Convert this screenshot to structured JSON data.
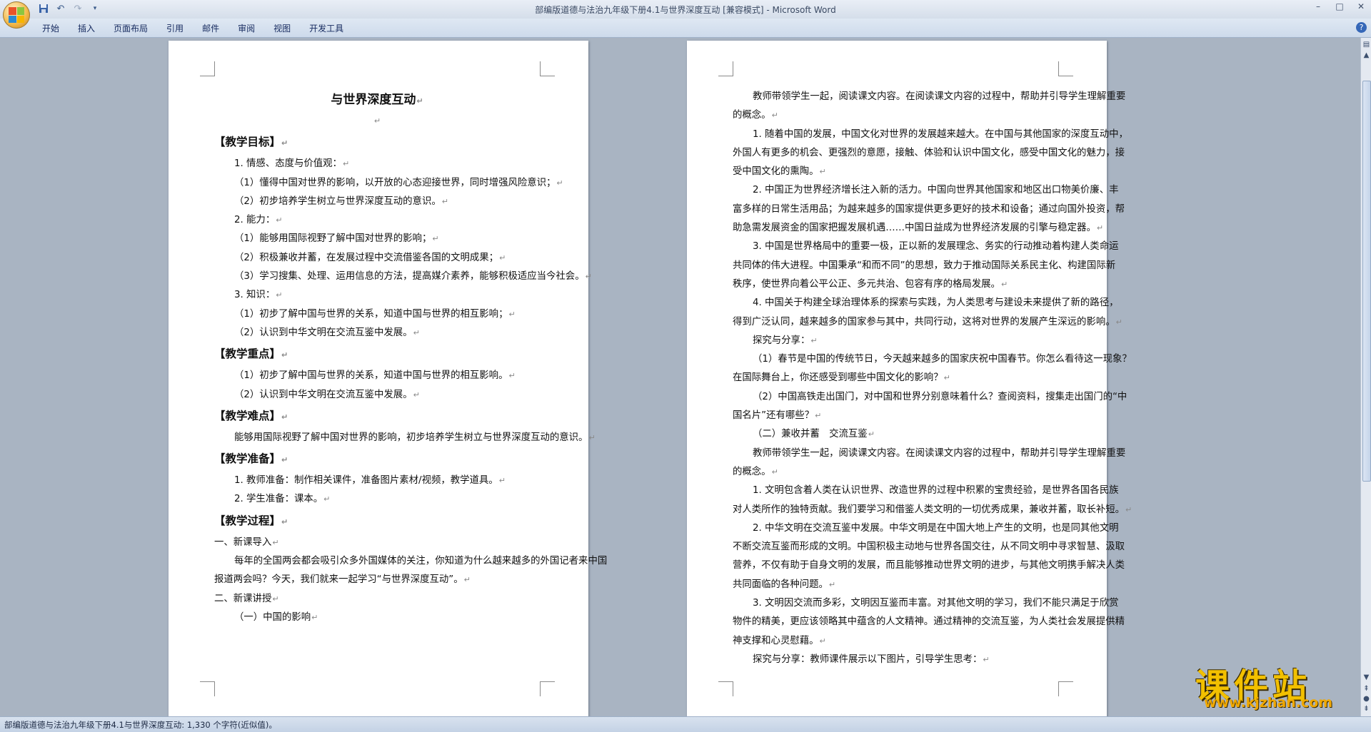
{
  "window": {
    "title": "部编版道德与法治九年级下册4.1与世界深度互动 [兼容模式] - Microsoft Word",
    "controls": {
      "minimize": "–",
      "maximize": "□",
      "close": "✕"
    }
  },
  "quick_access": {
    "save_icon": "save-icon",
    "undo_icon": "undo-icon",
    "redo_icon": "redo-icon",
    "customize_icon": "dropdown-icon"
  },
  "ribbon": {
    "tabs": [
      "开始",
      "插入",
      "页面布局",
      "引用",
      "邮件",
      "审阅",
      "视图",
      "开发工具"
    ],
    "help": "?"
  },
  "page1": {
    "title": "与世界深度互动",
    "paragraph_mark": "↵",
    "lines": [
      {
        "t": "【教学目标】",
        "s": "sec",
        "i": 0
      },
      {
        "t": "1. 情感、态度与价值观：",
        "s": "",
        "i": 28
      },
      {
        "t": "（1）懂得中国对世界的影响，以开放的心态迎接世界，同时增强风险意识；",
        "s": "",
        "i": 28
      },
      {
        "t": "（2）初步培养学生树立与世界深度互动的意识。",
        "s": "",
        "i": 28
      },
      {
        "t": "2. 能力：",
        "s": "",
        "i": 28
      },
      {
        "t": "（1）能够用国际视野了解中国对世界的影响；",
        "s": "",
        "i": 28
      },
      {
        "t": "（2）积极兼收并蓄，在发展过程中交流借鉴各国的文明成果；",
        "s": "",
        "i": 28
      },
      {
        "t": "（3）学习搜集、处理、运用信息的方法，提高媒介素养，能够积极适应当今社会。",
        "s": "",
        "i": 28
      },
      {
        "t": "3. 知识：",
        "s": "",
        "i": 28
      },
      {
        "t": "（1）初步了解中国与世界的关系，知道中国与世界的相互影响；",
        "s": "",
        "i": 28
      },
      {
        "t": "（2）认识到中华文明在交流互鉴中发展。",
        "s": "",
        "i": 28
      },
      {
        "t": "【教学重点】",
        "s": "sec",
        "i": 0
      },
      {
        "t": "（1）初步了解中国与世界的关系，知道中国与世界的相互影响。",
        "s": "",
        "i": 28
      },
      {
        "t": "（2）认识到中华文明在交流互鉴中发展。",
        "s": "",
        "i": 28
      },
      {
        "t": "【教学难点】",
        "s": "sec",
        "i": 0
      },
      {
        "t": "能够用国际视野了解中国对世界的影响，初步培养学生树立与世界深度互动的意识。",
        "s": "",
        "i": 28
      },
      {
        "t": "【教学准备】",
        "s": "sec",
        "i": 0
      },
      {
        "t": "1. 教师准备：制作相关课件，准备图片素材/视频，教学道具。",
        "s": "",
        "i": 28
      },
      {
        "t": "2. 学生准备：课本。",
        "s": "",
        "i": 28
      },
      {
        "t": "【教学过程】",
        "s": "sec",
        "i": 0
      },
      {
        "t": "一、新课导入",
        "s": "",
        "i": 0
      },
      {
        "t": "每年的全国两会都会吸引众多外国媒体的关注，你知道为什么越来越多的外国记者来中国",
        "s": "nomark",
        "i": 28
      },
      {
        "t": "报道两会吗？今天，我们就来一起学习“与世界深度互动”。",
        "s": "",
        "i": 0
      },
      {
        "t": "二、新课讲授",
        "s": "",
        "i": 0
      },
      {
        "t": "（一）中国的影响",
        "s": "",
        "i": 28
      }
    ]
  },
  "page2": {
    "lines": [
      {
        "t": "教师带领学生一起，阅读课文内容。在阅读课文内容的过程中，帮助并引导学生理解重要",
        "s": "nomark",
        "i": 28
      },
      {
        "t": "的概念。",
        "s": "",
        "i": 0
      },
      {
        "t": "1. 随着中国的发展，中国文化对世界的发展越来越大。在中国与其他国家的深度互动中，",
        "s": "nomark",
        "i": 28
      },
      {
        "t": "外国人有更多的机会、更强烈的意愿，接触、体验和认识中国文化，感受中国文化的魅力，接",
        "s": "nomark",
        "i": 0
      },
      {
        "t": "受中国文化的熏陶。",
        "s": "",
        "i": 0
      },
      {
        "t": "2. 中国正为世界经济增长注入新的活力。中国向世界其他国家和地区出口物美价廉、丰",
        "s": "nomark",
        "i": 28
      },
      {
        "t": "富多样的日常生活用品；为越来越多的国家提供更多更好的技术和设备；通过向国外投资，帮",
        "s": "nomark",
        "i": 0
      },
      {
        "t": "助急需发展资金的国家把握发展机遇……中国日益成为世界经济发展的引擎与稳定器。",
        "s": "",
        "i": 0
      },
      {
        "t": "3. 中国是世界格局中的重要一极，正以新的发展理念、务实的行动推动着构建人类命运",
        "s": "nomark",
        "i": 28
      },
      {
        "t": "共同体的伟大进程。中国秉承“和而不同”的思想，致力于推动国际关系民主化、构建国际新",
        "s": "nomark",
        "i": 0
      },
      {
        "t": "秩序，使世界向着公平公正、多元共治、包容有序的格局发展。",
        "s": "",
        "i": 0
      },
      {
        "t": "4. 中国关于构建全球治理体系的探索与实践，为人类思考与建设未来提供了新的路径，",
        "s": "nomark",
        "i": 28
      },
      {
        "t": "得到广泛认同，越来越多的国家参与其中，共同行动，这将对世界的发展产生深远的影响。",
        "s": "",
        "i": 0
      },
      {
        "t": "探究与分享：",
        "s": "",
        "i": 28
      },
      {
        "t": "（1）春节是中国的传统节日，今天越来越多的国家庆祝中国春节。你怎么看待这一现象？",
        "s": "nomark",
        "i": 28
      },
      {
        "t": "在国际舞台上，你还感受到哪些中国文化的影响？",
        "s": "",
        "i": 0
      },
      {
        "t": "（2）中国高铁走出国门，对中国和世界分别意味着什么？查阅资料，搜集走出国门的“中",
        "s": "nomark",
        "i": 28
      },
      {
        "t": "国名片”还有哪些？",
        "s": "",
        "i": 0
      },
      {
        "t": "（二）兼收并蓄　交流互鉴",
        "s": "",
        "i": 28
      },
      {
        "t": "教师带领学生一起，阅读课文内容。在阅读课文内容的过程中，帮助并引导学生理解重要",
        "s": "nomark",
        "i": 28
      },
      {
        "t": "的概念。",
        "s": "",
        "i": 0
      },
      {
        "t": "1. 文明包含着人类在认识世界、改造世界的过程中积累的宝贵经验，是世界各国各民族",
        "s": "nomark",
        "i": 28
      },
      {
        "t": "对人类所作的独特贡献。我们要学习和借鉴人类文明的一切优秀成果，兼收并蓄，取长补短。",
        "s": "",
        "i": 0
      },
      {
        "t": "2. 中华文明在交流互鉴中发展。中华文明是在中国大地上产生的文明，也是同其他文明",
        "s": "nomark",
        "i": 28
      },
      {
        "t": "不断交流互鉴而形成的文明。中国积极主动地与世界各国交往，从不同文明中寻求智慧、汲取",
        "s": "nomark",
        "i": 0
      },
      {
        "t": "营养，不仅有助于自身文明的发展，而且能够推动世界文明的进步，与其他文明携手解决人类",
        "s": "nomark",
        "i": 0
      },
      {
        "t": "共同面临的各种问题。",
        "s": "",
        "i": 0
      },
      {
        "t": "3. 文明因交流而多彩，文明因互鉴而丰富。对其他文明的学习，我们不能只满足于欣赏",
        "s": "nomark",
        "i": 28
      },
      {
        "t": "物件的精美，更应该领略其中蕴含的人文精神。通过精神的交流互鉴，为人类社会发展提供精",
        "s": "nomark",
        "i": 0
      },
      {
        "t": "神支撑和心灵慰藉。",
        "s": "",
        "i": 0
      },
      {
        "t": "探究与分享：教师课件展示以下图片，引导学生思考：",
        "s": "",
        "i": 28
      }
    ]
  },
  "status": {
    "text": "部编版道德与法治九年级下册4.1与世界深度互动: 1,330 个字符(近似值)。"
  },
  "watermark": {
    "cn": "课件站",
    "url": "www.kjzhan.com"
  },
  "colors": {
    "app_bg": "#a9b4c2",
    "ribbon": "#dfe8f3",
    "title_text": "#3b4a63",
    "watermark": "#f2c000"
  }
}
